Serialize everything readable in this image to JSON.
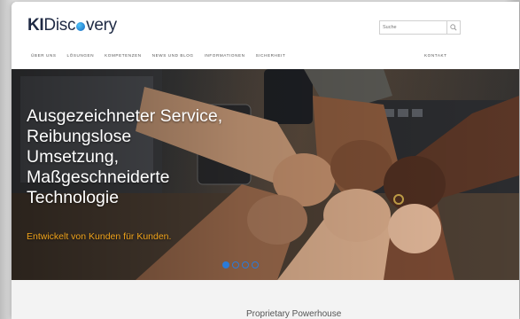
{
  "header": {
    "logo_prefix": "KI",
    "logo_mid": "Disc",
    "logo_suffix": "very",
    "search_placeholder": "Suche"
  },
  "nav": {
    "items": [
      "ÜBER UNS",
      "LÖSUNGEN",
      "KOMPETENZEN",
      "NEWS UND BLOG",
      "INFORMATIONEN",
      "SICHERHEIT"
    ],
    "contact": "KONTAKT"
  },
  "hero": {
    "title_lines": [
      "Ausgezeichneter Service,",
      "Reibungslose",
      "Umsetzung,",
      "Maßgeschneiderte",
      "Technologie"
    ],
    "subtitle": "Entwickelt von Kunden für Kunden.",
    "slides_total": 4,
    "slide_active": 1,
    "accent_color": "#f0a31b",
    "dot_color": "#2b7bd8"
  },
  "lower": {
    "title": "Proprietary Powerhouse"
  },
  "icons": {
    "search": "search-icon",
    "logo_dot": "globe-dot-icon"
  }
}
